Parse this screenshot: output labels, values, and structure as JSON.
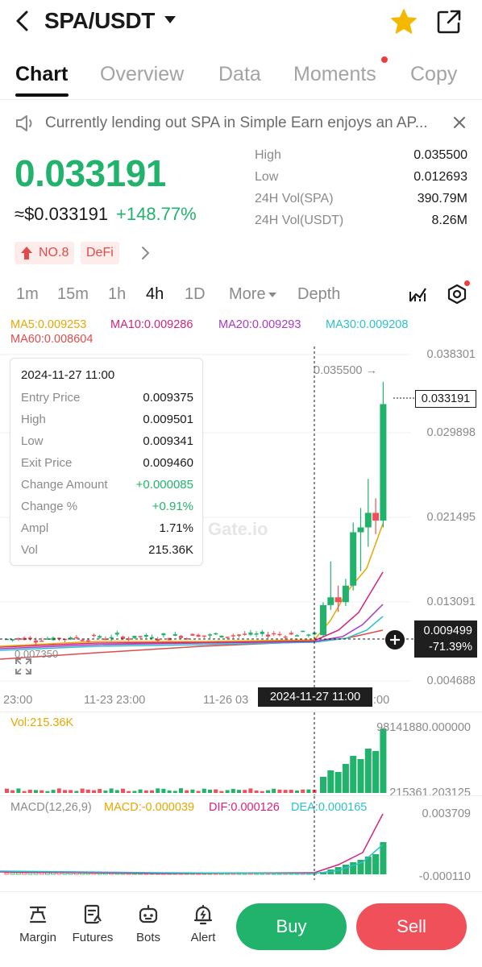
{
  "header": {
    "pair": "SPA/USDT"
  },
  "tabs": [
    {
      "label": "Chart"
    },
    {
      "label": "Overview"
    },
    {
      "label": "Data"
    },
    {
      "label": "Moments"
    },
    {
      "label": "Copy"
    }
  ],
  "notice": {
    "text": "Currently lending out SPA in Simple Earn enjoys an AP..."
  },
  "price": {
    "last": "0.033191",
    "usd": "≈$0.033191",
    "change": "+148.77%"
  },
  "stats": [
    {
      "label": "High",
      "value": "0.035500"
    },
    {
      "label": "Low",
      "value": "0.012693"
    },
    {
      "label": "24H Vol(SPA)",
      "value": "390.79M"
    },
    {
      "label": "24H Vol(USDT)",
      "value": "8.26M"
    }
  ],
  "badges": {
    "rank": "NO.8",
    "tag": "DeFi"
  },
  "intervals": [
    {
      "label": "1m"
    },
    {
      "label": "15m"
    },
    {
      "label": "1h"
    },
    {
      "label": "4h"
    },
    {
      "label": "1D"
    },
    {
      "label": "More"
    },
    {
      "label": "Depth"
    }
  ],
  "ma_legend": {
    "ma5": "MA5:0.009253",
    "ma10": "MA10:0.009286",
    "ma20": "MA20:0.009293",
    "ma30": "MA30:0.009208",
    "ma60": "MA60:0.008604"
  },
  "tooltip": {
    "date": "2024-11-27 11:00",
    "rows": [
      {
        "label": "Entry Price",
        "value": "0.009375"
      },
      {
        "label": "High",
        "value": "0.009501"
      },
      {
        "label": "Low",
        "value": "0.009341"
      },
      {
        "label": "Exit Price",
        "value": "0.009460"
      },
      {
        "label": "Change Amount",
        "value": "+0.000085"
      },
      {
        "label": "Change %",
        "value": "+0.91%"
      },
      {
        "label": "Ampl",
        "value": "1.71%"
      },
      {
        "label": "Vol",
        "value": "215.36K"
      }
    ]
  },
  "watermark": "Gate.io",
  "chart": {
    "y_ticks": [
      "0.038301",
      "0.029898",
      "0.021495",
      "0.013091",
      "0.004688"
    ],
    "x_ticks": [
      "23:00",
      "11-23 23:00",
      "11-26 03"
    ],
    "x_tick_tail": ":00",
    "high_marker": "0.035500",
    "low_marker": "0.007350",
    "last_price_tag": "0.033191",
    "crosshair_price": "0.009499",
    "crosshair_pct": "-71.39%",
    "crosshair_date": "2024-11-27 11:00"
  },
  "volume": {
    "label": "Vol:215.36K",
    "max": "98141880.000000",
    "current": "215361.203125"
  },
  "macd": {
    "label": "MACD(12,26,9)",
    "macd": "MACD:-0.000039",
    "dif": "DIF:0.000126",
    "dea": "DEA:0.000165",
    "max": "0.003709",
    "min": "-0.000110"
  },
  "colors": {
    "up": "#21b36b",
    "down": "#f0505a",
    "ma5": "#e8a600",
    "ma10": "#d4237a",
    "ma20": "#a93ac9",
    "ma30": "#2cc1c9",
    "ma60": "#e14b4b"
  },
  "bottom_nav": [
    {
      "label": "Margin",
      "icon": "margin-icon"
    },
    {
      "label": "Futures",
      "icon": "futures-icon"
    },
    {
      "label": "Bots",
      "icon": "bots-icon"
    },
    {
      "label": "Alert",
      "icon": "alert-icon"
    }
  ],
  "actions": {
    "buy": "Buy",
    "sell": "Sell"
  }
}
